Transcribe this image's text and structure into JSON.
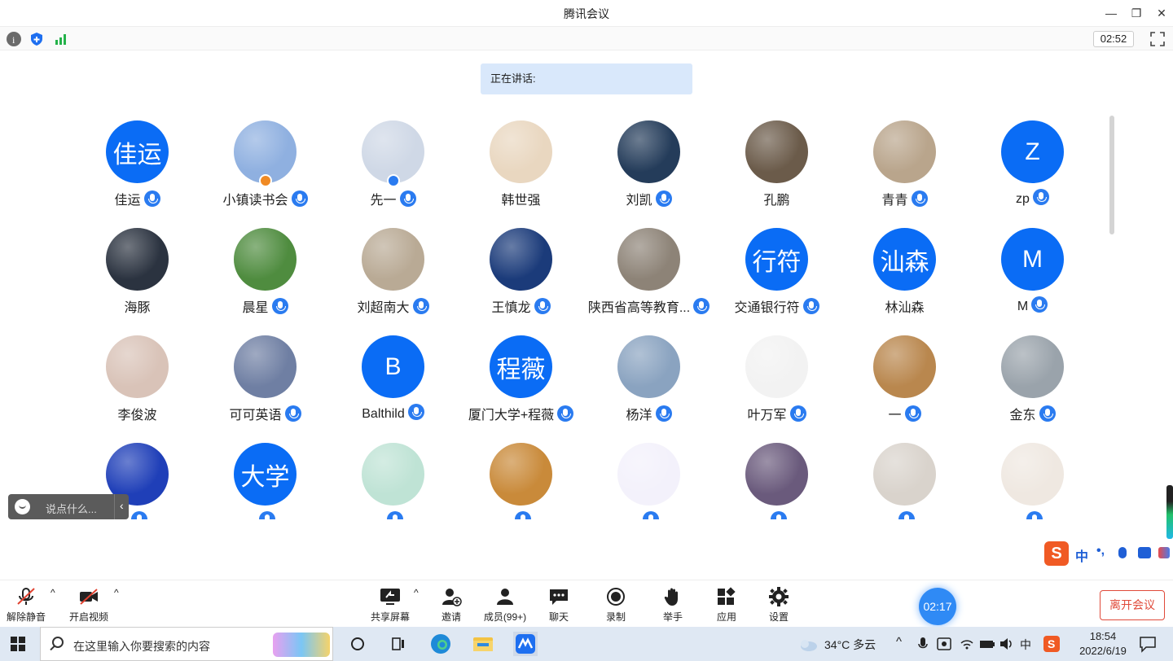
{
  "window": {
    "title": "腾讯会议",
    "minimize": "—",
    "restore": "❐",
    "close": "✕"
  },
  "infobar": {
    "duration": "02:52",
    "icons": [
      "info-icon",
      "shield-icon",
      "signal-icon",
      "fullscreen-icon"
    ]
  },
  "speaking": {
    "label": "正在讲话:"
  },
  "participants": [
    {
      "name": "佳运",
      "avatar_text": "佳运",
      "mic": true
    },
    {
      "name": "小镇读书会",
      "avatar_text": "",
      "mic": true,
      "badge": "host"
    },
    {
      "name": "先一",
      "avatar_text": "",
      "mic": true,
      "badge": "cohost"
    },
    {
      "name": "韩世强",
      "avatar_text": "",
      "mic": false
    },
    {
      "name": "刘凯",
      "avatar_text": "",
      "mic": true
    },
    {
      "name": "孔鹏",
      "avatar_text": "",
      "mic": false
    },
    {
      "name": "青青",
      "avatar_text": "",
      "mic": true
    },
    {
      "name": "zp",
      "avatar_text": "Z",
      "mic": true
    },
    {
      "name": "海豚",
      "avatar_text": "",
      "mic": false
    },
    {
      "name": "晨星",
      "avatar_text": "",
      "mic": true
    },
    {
      "name": "刘超南大",
      "avatar_text": "",
      "mic": true
    },
    {
      "name": "王慎龙",
      "avatar_text": "",
      "mic": true
    },
    {
      "name": "陕西省高等教育...",
      "avatar_text": "",
      "mic": true
    },
    {
      "name": "交通银行符",
      "avatar_text": "行符",
      "mic": true
    },
    {
      "name": "林汕森",
      "avatar_text": "汕森",
      "mic": false
    },
    {
      "name": "M",
      "avatar_text": "M",
      "mic": true
    },
    {
      "name": "李俊波",
      "avatar_text": "",
      "mic": false
    },
    {
      "name": "可可英语",
      "avatar_text": "",
      "mic": true
    },
    {
      "name": "Balthild",
      "avatar_text": "B",
      "mic": true
    },
    {
      "name": "厦门大学+程薇",
      "avatar_text": "程薇",
      "mic": true
    },
    {
      "name": "杨洋",
      "avatar_text": "",
      "mic": true
    },
    {
      "name": "叶万军",
      "avatar_text": "",
      "mic": true
    },
    {
      "name": "一",
      "avatar_text": "",
      "mic": true
    },
    {
      "name": "金东",
      "avatar_text": "",
      "mic": true
    },
    {
      "name": "",
      "avatar_text": "",
      "mic": true
    },
    {
      "name": "",
      "avatar_text": "大学",
      "mic": true
    },
    {
      "name": "",
      "avatar_text": "",
      "mic": true
    },
    {
      "name": "",
      "avatar_text": "",
      "mic": true
    },
    {
      "name": "",
      "avatar_text": "",
      "mic": true
    },
    {
      "name": "",
      "avatar_text": "",
      "mic": true
    },
    {
      "name": "",
      "avatar_text": "",
      "mic": true
    },
    {
      "name": "",
      "avatar_text": "",
      "mic": true
    }
  ],
  "avatar_colors": [
    "#0a6cf5",
    "#8fb0e0",
    "#cfd8e6",
    "#e9d7c0",
    "#243c5a",
    "#6b5b4a",
    "#b9a58c",
    "#0a6cf5",
    "#2b3340",
    "#4f8c3f",
    "#b9aa95",
    "#1b3b7a",
    "#8d8377",
    "#0a6cf5",
    "#0a6cf5",
    "#0a6cf5",
    "#d9c3b8",
    "#6f7fa3",
    "#0a6cf5",
    "#0a6cf5",
    "#8aa3c0",
    "#f2f2f2",
    "#b9874e",
    "#9aa3ab",
    "#1f3fb8",
    "#0a6cf5",
    "#bfe3d5",
    "#c98a3a",
    "#f3f1fb",
    "#6a5a7c",
    "#d9d3cc",
    "#efe8e1"
  ],
  "chat": {
    "placeholder": "说点什么...",
    "toggle": "‹"
  },
  "ime": {
    "mode": "中",
    "punct": "•,",
    "logo": "S"
  },
  "toolbar": {
    "mute_label": "解除静音",
    "video_label": "开启视频",
    "share_label": "共享屏幕",
    "invite_label": "邀请",
    "members_label": "成员(99+)",
    "chat_label": "聊天",
    "record_label": "录制",
    "raise_label": "举手",
    "apps_label": "应用",
    "settings_label": "设置",
    "meeting_time": "02:17",
    "leave_label": "离开会议",
    "caret": "^"
  },
  "taskbar": {
    "search_placeholder": "在这里输入你要搜索的内容",
    "weather": "34°C 多云",
    "time": "18:54",
    "date": "2022/6/19",
    "ime_indicator": "中",
    "tray_caret": "^"
  }
}
